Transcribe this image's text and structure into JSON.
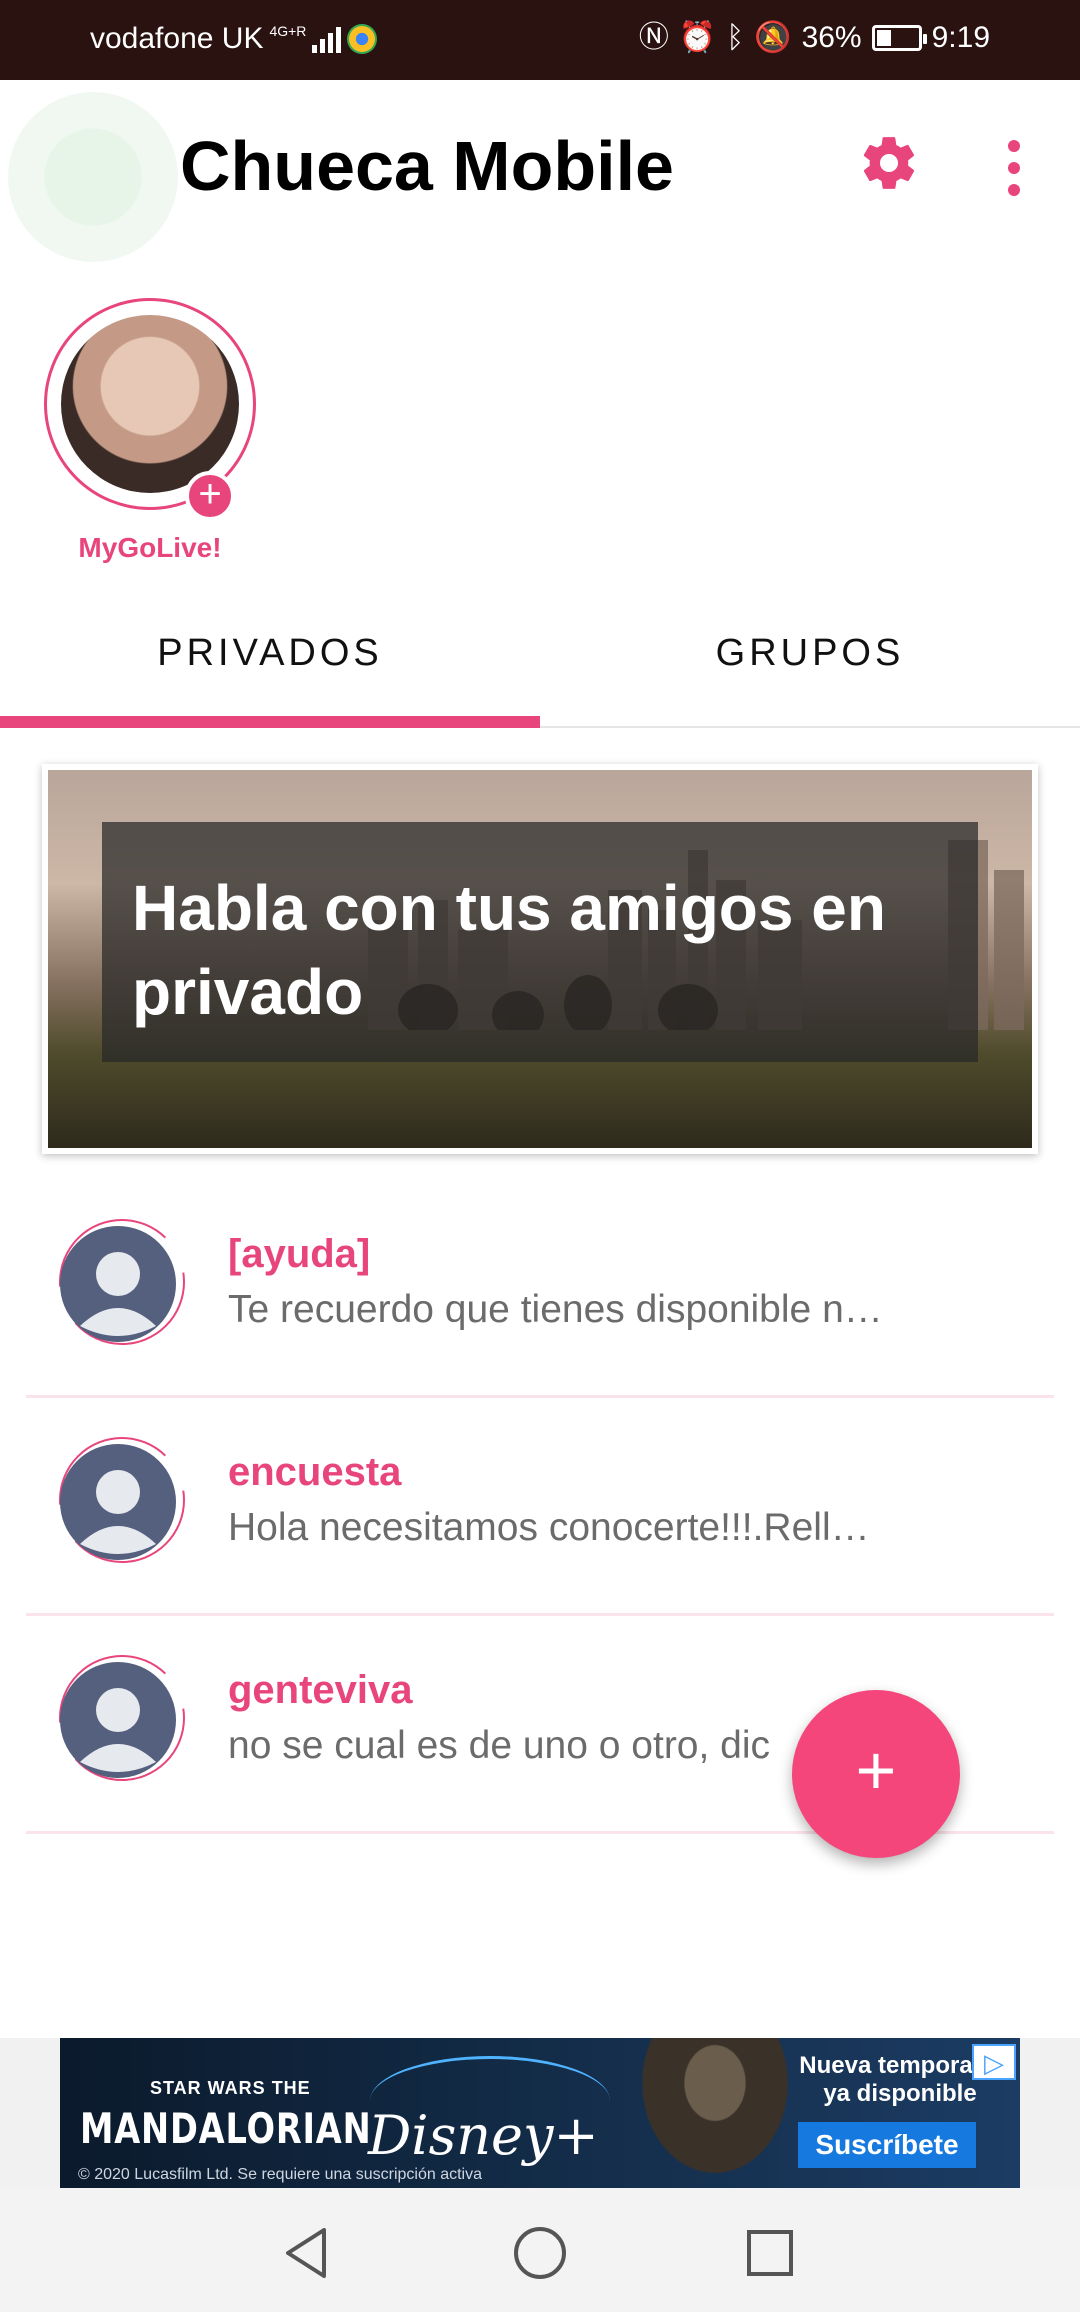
{
  "status_bar": {
    "carrier": "vodafone UK",
    "network": "4G+R",
    "battery": "36%",
    "battery_level": 0.36,
    "time": "9:19",
    "icons": [
      "nfc-icon",
      "alarm-icon",
      "bluetooth-icon",
      "bell-off-icon",
      "battery-icon"
    ]
  },
  "app_bar": {
    "title": "Chueca Mobile",
    "settings_icon": "gear-icon",
    "menu_icon": "overflow-menu-icon"
  },
  "story": {
    "label": "MyGoLive!",
    "add_glyph": "+"
  },
  "tabs": [
    {
      "label": "PRIVADOS",
      "active": true
    },
    {
      "label": "GRUPOS",
      "active": false
    }
  ],
  "banner": {
    "text": "Habla con tus amigos en privado"
  },
  "conversations": [
    {
      "name": "[ayuda]",
      "preview": "Te recuerdo que tienes disponible n…"
    },
    {
      "name": "encuesta",
      "preview": "Hola necesitamos conocerte!!!.Rell…"
    },
    {
      "name": "genteviva",
      "preview": "no se cual es de uno o otro, dic"
    }
  ],
  "fab": {
    "glyph": "+"
  },
  "ad": {
    "star_wars": "STAR WARS",
    "the": "THE",
    "title": "MANDALORIAN",
    "brand": "Disney+",
    "headline": "Nueva temporada ya disponible",
    "cta": "Suscríbete",
    "copyright": "© 2020 Lucasfilm Ltd. Se requiere una suscripción activa",
    "badge": "▷"
  },
  "nav": {
    "back": "back-icon",
    "home": "home-icon",
    "recents": "recents-icon"
  },
  "colors": {
    "accent": "#e8457c",
    "status_bar": "#2a1210"
  }
}
